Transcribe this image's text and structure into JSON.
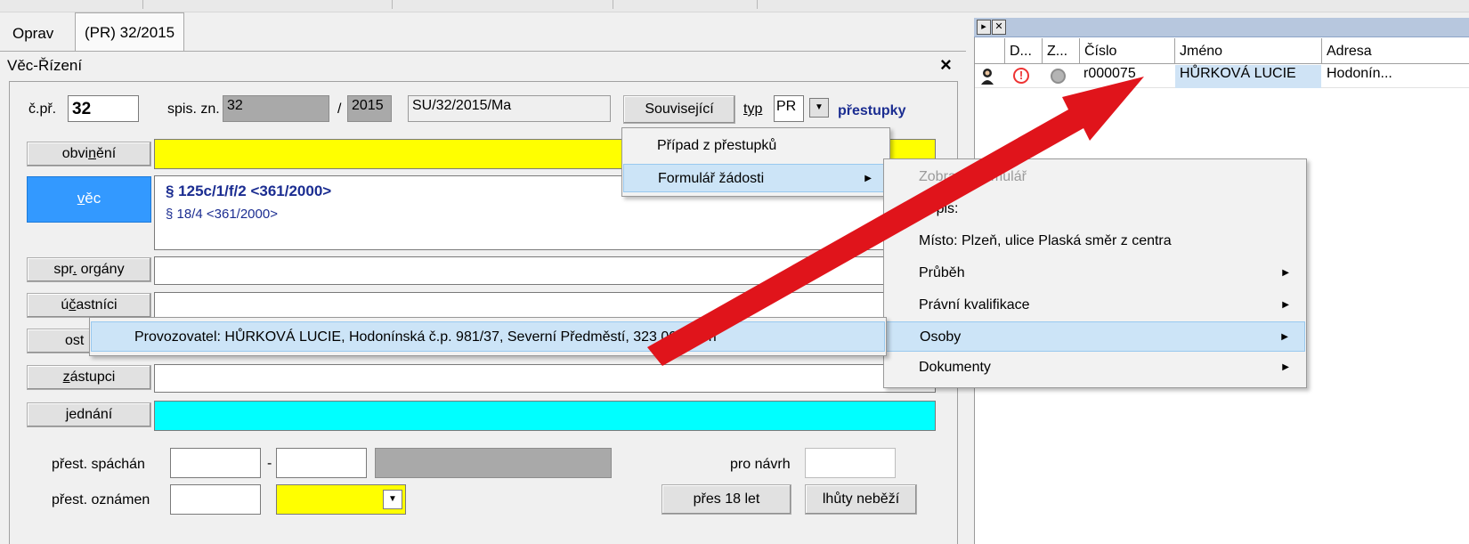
{
  "tabs": [
    "Oprav",
    "(PR) 32/2015"
  ],
  "form": {
    "title": "Věc-Řízení",
    "close_glyph": "×",
    "cpr_label": "č.př.",
    "cpr_value": "32",
    "spis_label": "spis. zn.",
    "spis_value": "32",
    "slash": "/",
    "spis_year": "2015",
    "full_ref": "SU/32/2015/Ma",
    "souvisejici_label": "Související",
    "typ_label": "typ",
    "typ_value": "PR",
    "typ_name": "přestupky",
    "buttons": {
      "obvineni": "obvinění",
      "vec": "věc",
      "spr_organy": "spr. orgány",
      "ucastnici": "účastníci",
      "ost": "ost",
      "zastupci": "zástupci",
      "jednani": "jednání"
    },
    "vec_lines": [
      "§ 125c/1/f/2 <361/2000>",
      "§ 18/4 <361/2000>"
    ],
    "prest_spachan_label": "přest. spáchán",
    "dash": "-",
    "pro_navrh_label": "pro návrh",
    "prest_oznamen_label": "přest. oznámen",
    "pres18_label": "přes 18 let",
    "lhuty_label": "lhůty neběží"
  },
  "menu1": {
    "items": [
      "Případ z přestupků",
      "Formulář žádosti"
    ]
  },
  "menu2": {
    "items": [
      "Zobrazit formulář",
      "Popis:",
      "Místo: Plzeň, ulice Plaská směr z centra",
      "Průběh",
      "Právní kvalifikace",
      "Osoby",
      "Dokumenty"
    ]
  },
  "menu3": {
    "item": "Provozovatel: HŮRKOVÁ LUCIE, Hodonínská č.p. 981/37, Severní Předměstí, 323 00  Plzeň"
  },
  "grid": {
    "controls": [
      "▸",
      "✕"
    ],
    "headers": [
      "D...",
      "Z...",
      "Číslo",
      "Jméno",
      "Adresa"
    ],
    "row": {
      "status": "!",
      "cislo": "r000075",
      "jmeno": "HŮRKOVÁ LUCIE",
      "adresa": "Hodonín..."
    }
  },
  "colors": {
    "accent_blue": "#3399ff",
    "highlight_yellow": "#ffff00",
    "highlight_cyan": "#00ffff",
    "annotation_arrow": "#e0141b",
    "menu_highlight": "#cce4f7"
  }
}
